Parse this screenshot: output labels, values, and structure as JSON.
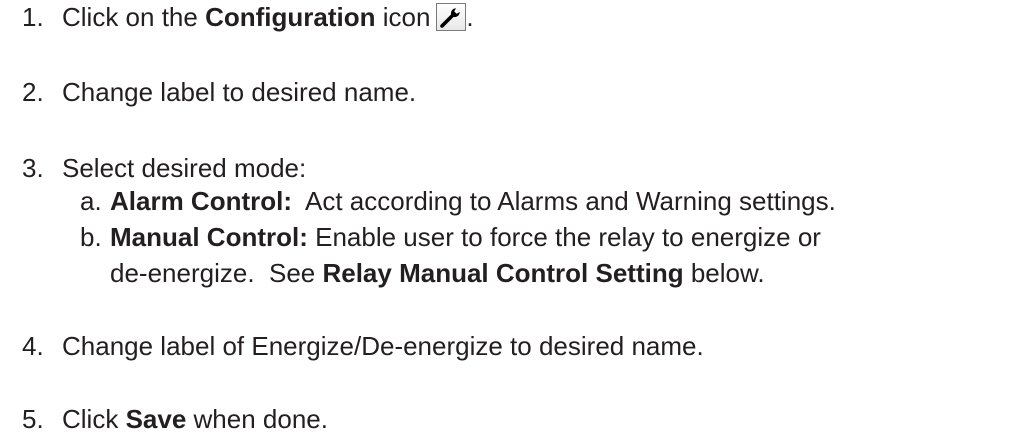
{
  "steps": [
    {
      "num": "1.",
      "prefix": "Click on the ",
      "bold": "Configuration",
      "suffix": " icon",
      "icon": "wrench-icon",
      "end": "."
    },
    {
      "num": "2.",
      "text": "Change label to desired name."
    },
    {
      "num": "3.",
      "text": "Select desired mode:",
      "subitems": [
        {
          "letter": "a.",
          "bold": "Alarm Control:",
          "text": "  Act according to Alarms and Warning settings."
        },
        {
          "letter": "b.",
          "bold": "Manual Control:",
          "text": " Enable user to force the relay to energize or",
          "cont_text": "de-energize.  See ",
          "cont_bold": "Relay Manual Control Setting",
          "cont_end": " below."
        }
      ]
    },
    {
      "num": "4.",
      "text": "Change label of Energize/De-energize to desired name."
    },
    {
      "num": "5.",
      "prefix": "Click ",
      "bold": "Save",
      "suffix": " when done."
    }
  ]
}
